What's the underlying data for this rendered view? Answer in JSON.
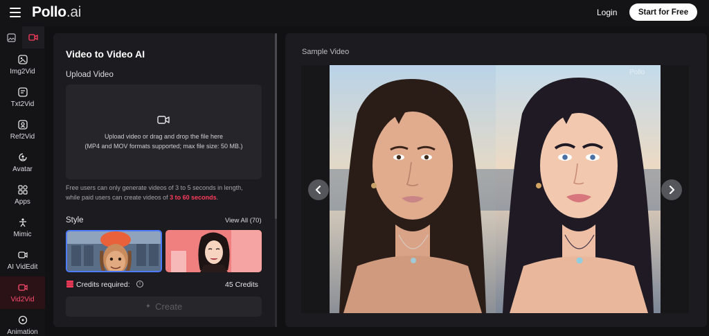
{
  "header": {
    "logo_main": "Pollo",
    "logo_tld": ".ai",
    "login_label": "Login",
    "start_label": "Start for Free"
  },
  "rail": {
    "items": [
      {
        "label": "Img2Vid",
        "icon": "image-video-icon"
      },
      {
        "label": "Txt2Vid",
        "icon": "text-video-icon"
      },
      {
        "label": "Ref2Vid",
        "icon": "reference-video-icon"
      },
      {
        "label": "Avatar",
        "icon": "avatar-icon"
      },
      {
        "label": "Apps",
        "icon": "apps-icon"
      },
      {
        "label": "Mimic",
        "icon": "mimic-icon"
      },
      {
        "label": "AI VidEdit",
        "icon": "video-edit-icon"
      },
      {
        "label": "Vid2Vid",
        "icon": "video-to-video-icon",
        "active": true
      },
      {
        "label": "Animation",
        "icon": "animation-icon"
      }
    ]
  },
  "panel": {
    "title": "Video to Video AI",
    "upload_label": "Upload Video",
    "dropzone_line1": "Upload video or drag and drop the file here",
    "dropzone_line2": "(MP4 and MOV formats supported; max file size: 50 MB.)",
    "note_line1": "Free users can only generate videos of 3 to 5 seconds in length,",
    "note_line2_prefix": "while paid users can create videos of ",
    "note_line2_highlight": "3 to 60 seconds",
    "note_line2_suffix": ".",
    "style_label": "Style",
    "view_all": "View All (70)",
    "credits_label": "Credits required:",
    "credits_value": "45 Credits",
    "create_label": "Create"
  },
  "preview": {
    "label": "Sample Video",
    "watermark": "Pollo"
  },
  "colors": {
    "accent": "#ff3b5c",
    "selected_border": "#4f7cff",
    "background": "#111114",
    "panel": "#1c1c20"
  }
}
